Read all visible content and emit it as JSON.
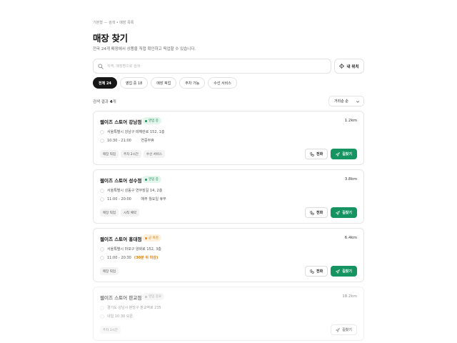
{
  "breadcrumb": "기본형 — 검색 • 매장 목록",
  "title": "매장 찾기",
  "subtitle": "전국 24개 매장에서 상품을 직접 확인하고 픽업할 수 있습니다.",
  "search": {
    "placeholder": "지역, 매장명으로 검색",
    "value": ""
  },
  "location_button": {
    "label": "내 위치",
    "icon": "crosshair-icon"
  },
  "filters": [
    {
      "label": "전체 24",
      "active": true
    },
    {
      "label": "영업 중 18",
      "active": false
    },
    {
      "label": "매장 픽업",
      "active": false
    },
    {
      "label": "주차 가능",
      "active": false
    },
    {
      "label": "수선 서비스",
      "active": false
    }
  ],
  "results": {
    "prefix": "검색 결과 ",
    "count": "4",
    "suffix": "개"
  },
  "sort": {
    "selected": "거리순 순"
  },
  "colors": {
    "primary": "#159462",
    "open": "#1c8f5c",
    "soon": "#e38a14",
    "ended": "#999999"
  },
  "stores": [
    {
      "name": "웹이즈 스토어 강남점",
      "status": "영업 중",
      "status_type": "open",
      "distance": "1.2km",
      "address": "서울특별시 강남구 테헤란로 152, 1층",
      "hours": "10:30 - 21:00",
      "hours_note": "연중무휴",
      "hours_warn": "",
      "tags": [
        "매장 픽업",
        "주차 2시간",
        "수선 서비스"
      ],
      "call_label": "전화",
      "directions_label": "길찾기"
    },
    {
      "name": "웹이즈 스토어 성수점",
      "status": "영업 중",
      "status_type": "open",
      "distance": "3.8km",
      "address": "서울특별시 성동구 연무장길 14, 2층",
      "hours": "11:00 - 20:00",
      "hours_note": "매주 월요일 휴무",
      "hours_warn": "",
      "tags": [
        "매장 픽업",
        "시착 예약"
      ],
      "call_label": "전화",
      "directions_label": "길찾기"
    },
    {
      "name": "웹이즈 스토어 홍대점",
      "status": "곧 마감",
      "status_type": "soon",
      "distance": "6.4km",
      "address": "서울특별시 마포구 양화로 152, 3층",
      "hours": "11:00 - 20:30",
      "hours_note": "",
      "hours_warn": "(30분 뒤 마감)",
      "tags": [
        "매장 픽업"
      ],
      "call_label": "전화",
      "directions_label": "길찾기"
    },
    {
      "name": "웹이즈 스토어 판교점",
      "status": "영업 종료",
      "status_type": "ended",
      "distance": "18.2km",
      "address": "경기도 성남시 분당구 판교역로 235",
      "hours": "내일 10:30 오픈",
      "hours_note": "",
      "hours_warn": "",
      "tags": [
        "주차 3시간"
      ],
      "call_label": "",
      "directions_label": "길찾기"
    }
  ]
}
